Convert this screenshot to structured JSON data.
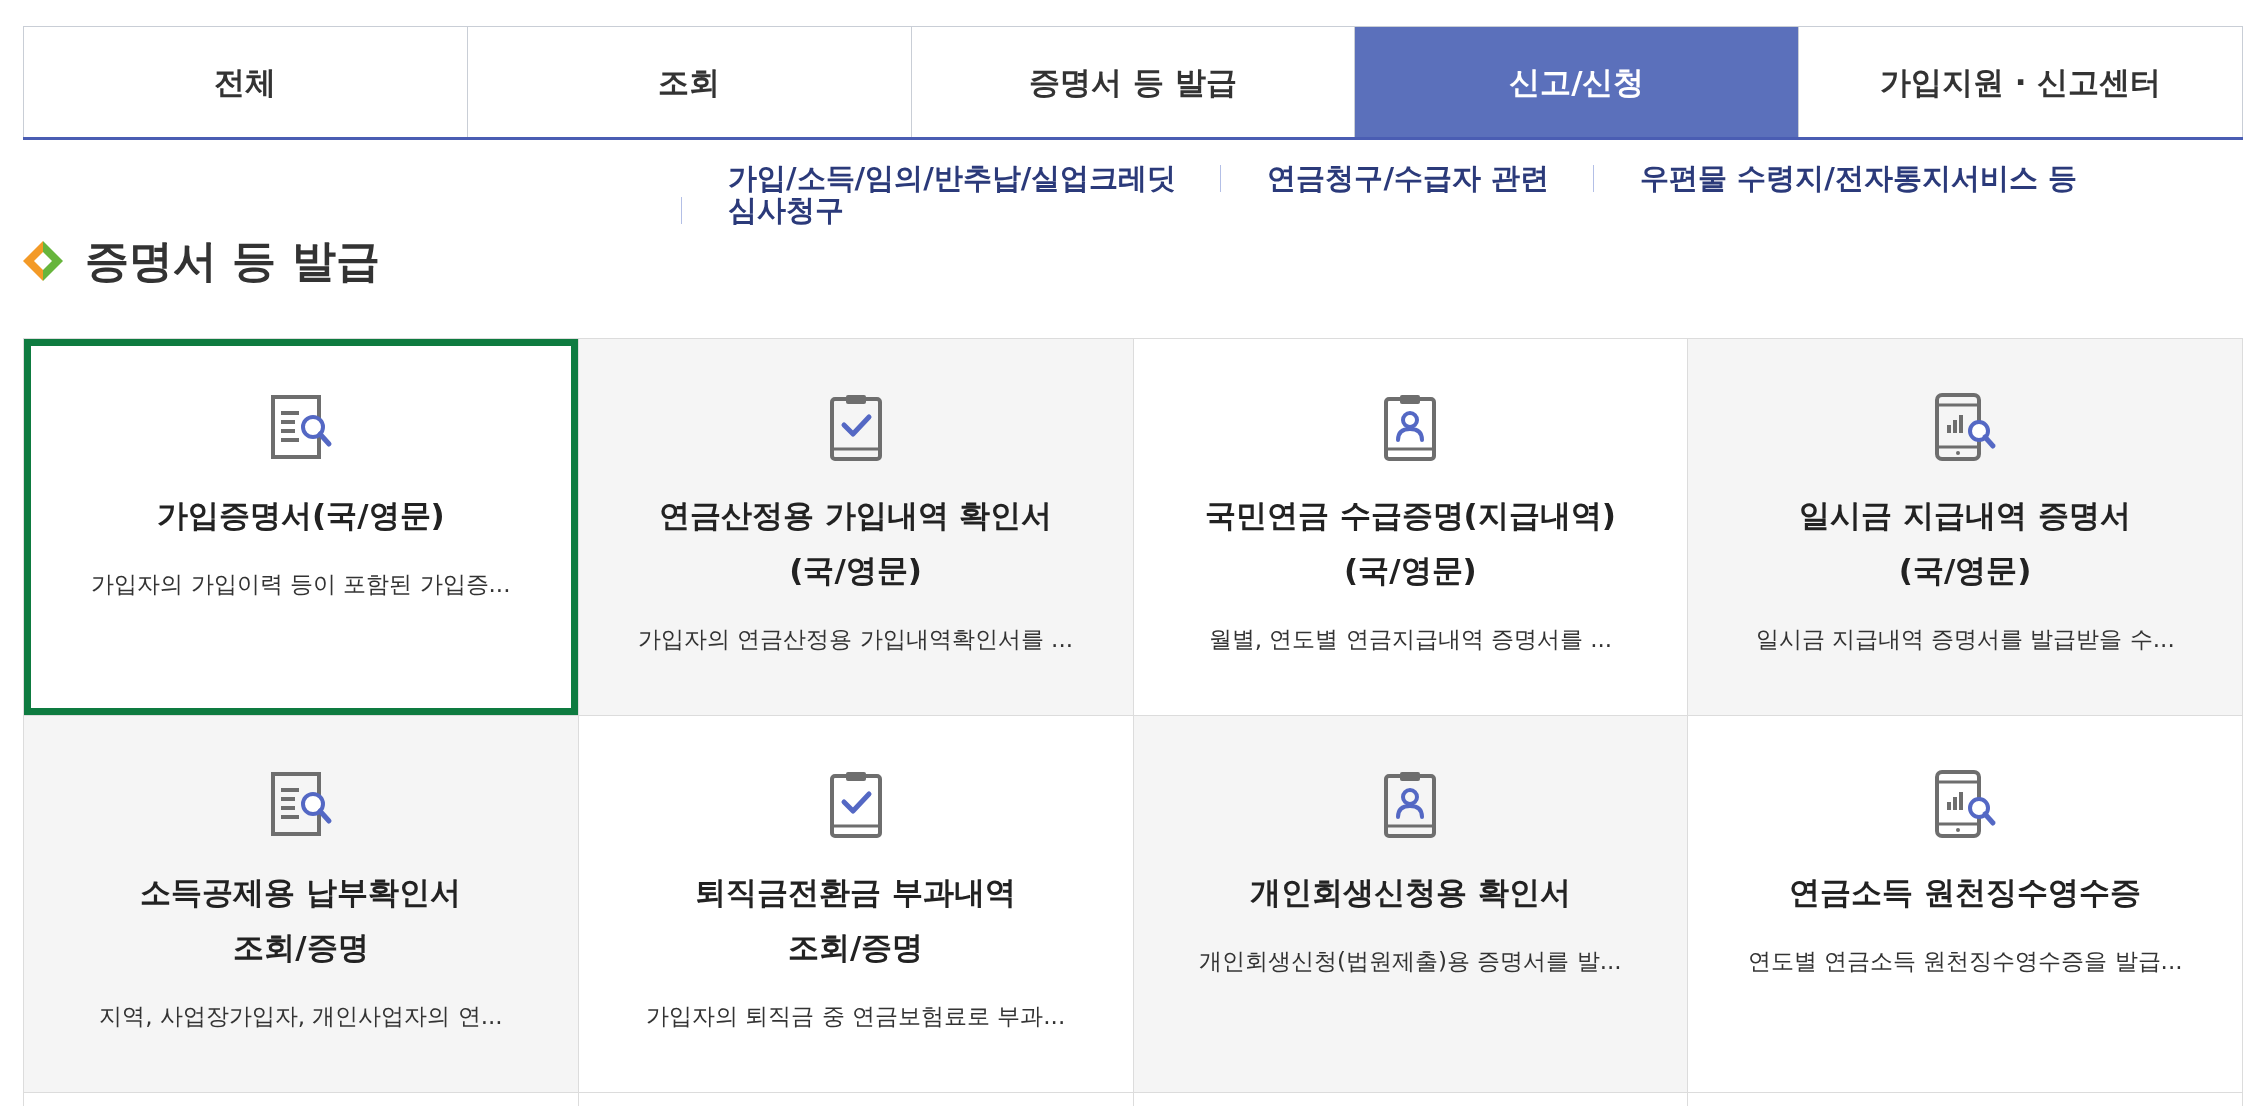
{
  "tabs": [
    {
      "label": "전체",
      "selected": false
    },
    {
      "label": "조회",
      "selected": false
    },
    {
      "label": "증명서 등 발급",
      "selected": false
    },
    {
      "label": "신고/신청",
      "selected": true
    },
    {
      "label": "가입지원 · 신고센터",
      "selected": false
    }
  ],
  "sub_links": [
    "가입/소득/임의/반추납/실업크레딧",
    "연금청구/수급자 관련",
    "우편물 수령지/전자통지서비스 등",
    "심사청구"
  ],
  "section": {
    "title": "증명서 등 발급"
  },
  "cards": [
    {
      "kind": "lookup",
      "title_lines": [
        "가입증명서(국/영문)"
      ],
      "description": "가입자의 가입이력 등이 포함된 가입증...",
      "selected": true
    },
    {
      "kind": "checklist",
      "title_lines": [
        "연금산정용 가입내역 확인서",
        "(국/영문)"
      ],
      "description": "가입자의 연금산정용 가입내역확인서를 ...",
      "selected": false
    },
    {
      "kind": "profile",
      "title_lines": [
        "국민연금 수급증명(지급내역)",
        "(국/영문)"
      ],
      "description": "월별, 연도별 연금지급내역 증명서를 ...",
      "selected": false
    },
    {
      "kind": "mobile",
      "title_lines": [
        "일시금 지급내역 증명서",
        "(국/영문)"
      ],
      "description": "일시금 지급내역 증명서를 발급받을 수...",
      "selected": false
    },
    {
      "kind": "lookup",
      "title_lines": [
        "소득공제용 납부확인서",
        "조회/증명"
      ],
      "description": "지역, 사업장가입자, 개인사업자의 연...",
      "selected": false
    },
    {
      "kind": "checklist",
      "title_lines": [
        "퇴직금전환금 부과내역",
        "조회/증명"
      ],
      "description": "가입자의 퇴직금 중 연금보험료로 부과...",
      "selected": false
    },
    {
      "kind": "profile",
      "title_lines": [
        "개인회생신청용 확인서"
      ],
      "description": "개인회생신청(법원제출)용 증명서를 발...",
      "selected": false
    },
    {
      "kind": "mobile",
      "title_lines": [
        "연금소득 원천징수영수증"
      ],
      "description": "연도별 연금소득 원천징수영수증을 발급...",
      "selected": false
    }
  ]
}
